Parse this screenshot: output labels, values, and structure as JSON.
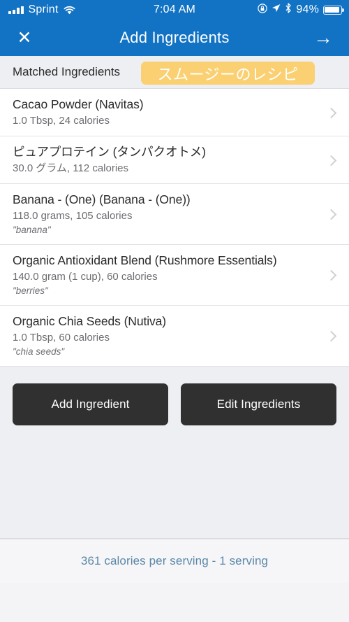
{
  "status_bar": {
    "carrier": "Sprint",
    "time": "7:04 AM",
    "battery_percent": "94%",
    "icons": [
      "signal-bars-icon",
      "wifi-icon",
      "rotation-lock-icon",
      "location-arrow-icon",
      "bluetooth-icon",
      "battery-icon"
    ]
  },
  "nav_bar": {
    "title": "Add Ingredients",
    "close_icon": "close-icon",
    "close_glyph": "✕",
    "next_icon": "arrow-right-icon",
    "next_glyph": "→",
    "background_color": "#1273c4"
  },
  "section": {
    "title": "Matched Ingredients",
    "badge_text": "スムージーのレシピ",
    "badge_color": "#fad073"
  },
  "ingredients": [
    {
      "name": "Cacao Powder (Navitas)",
      "detail": "1.0 Tbsp, 24 calories",
      "note": ""
    },
    {
      "name": "ピュアプロテイン (タンパクオトメ)",
      "detail": "30.0 グラム, 112 calories",
      "note": ""
    },
    {
      "name": "Banana - (One) (Banana - (One))",
      "detail": "118.0 grams, 105 calories",
      "note": "\"banana\""
    },
    {
      "name": "Organic Antioxidant Blend (Rushmore Essentials)",
      "detail": "140.0 gram (1 cup), 60 calories",
      "note": "\"berries\""
    },
    {
      "name": "Organic Chia Seeds (Nutiva)",
      "detail": "1.0 Tbsp, 60 calories",
      "note": "\"chia seeds\""
    }
  ],
  "actions": {
    "add_label": "Add Ingredient",
    "edit_label": "Edit Ingredients",
    "button_color": "#303030"
  },
  "footer": {
    "summary": "361 calories per serving - 1 serving",
    "text_color": "#5b87a8"
  }
}
